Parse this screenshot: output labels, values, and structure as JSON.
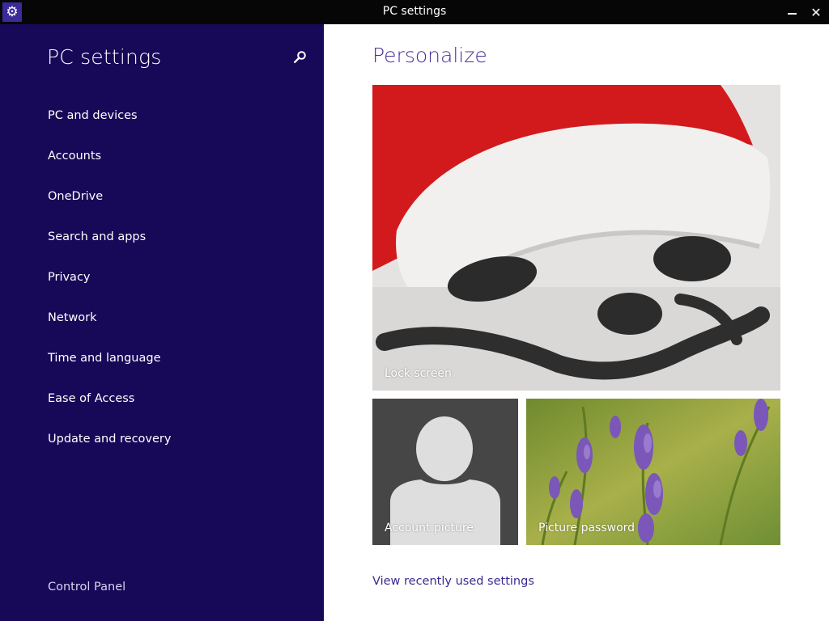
{
  "window": {
    "title": "PC settings",
    "close_glyph": "✕",
    "app_icon": "gear-icon"
  },
  "sidebar": {
    "title": "PC settings",
    "search_icon": "search-icon",
    "items": [
      {
        "label": "PC and devices"
      },
      {
        "label": "Accounts"
      },
      {
        "label": "OneDrive"
      },
      {
        "label": "Search and apps"
      },
      {
        "label": "Privacy"
      },
      {
        "label": "Network"
      },
      {
        "label": "Time and language"
      },
      {
        "label": "Ease of Access"
      },
      {
        "label": "Update and recovery"
      }
    ],
    "control_panel": "Control Panel"
  },
  "main": {
    "title": "Personalize",
    "tiles": {
      "lock_screen": "Lock screen",
      "account_picture": "Account picture",
      "picture_password": "Picture password"
    },
    "view_recent": "View recently used settings"
  },
  "colors": {
    "sidebar_bg": "#180858",
    "accent": "#4b2f9a",
    "titlebar_bg": "#060606"
  }
}
